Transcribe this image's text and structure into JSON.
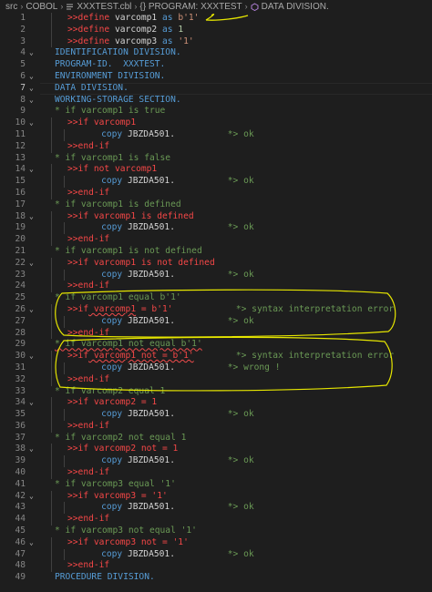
{
  "breadcrumb": {
    "items": [
      "src",
      "COBOL",
      "XXXTEST.cbl",
      "{} PROGRAM: XXXTEST",
      "DATA DIVISION."
    ]
  },
  "editor": {
    "current_line": 7,
    "lines": [
      {
        "n": "1",
        "fold": "",
        "indent": 1,
        "tokens": [
          [
            ">>define",
            "dir"
          ],
          [
            " varcomp1 ",
            "plain"
          ],
          [
            "as",
            "kw"
          ],
          [
            " b'1'",
            "str"
          ]
        ]
      },
      {
        "n": "2",
        "fold": "",
        "indent": 1,
        "tokens": [
          [
            ">>define",
            "dir"
          ],
          [
            " varcomp2 ",
            "plain"
          ],
          [
            "as",
            "kw"
          ],
          [
            " 1",
            "num"
          ]
        ]
      },
      {
        "n": "3",
        "fold": "",
        "indent": 1,
        "tokens": [
          [
            ">>define",
            "dir"
          ],
          [
            " varcomp3 ",
            "plain"
          ],
          [
            "as",
            "kw"
          ],
          [
            " '1'",
            "str"
          ]
        ]
      },
      {
        "n": "4",
        "fold": "v",
        "indent": 0,
        "tokens": [
          [
            "IDENTIFICATION DIVISION.",
            "div"
          ]
        ]
      },
      {
        "n": "5",
        "fold": "",
        "indent": 0,
        "tokens": [
          [
            "PROGRAM-ID.  XXXTEST.",
            "div"
          ]
        ]
      },
      {
        "n": "6",
        "fold": "v",
        "indent": 0,
        "tokens": [
          [
            "ENVIRONMENT DIVISION.",
            "div"
          ]
        ]
      },
      {
        "n": "7",
        "fold": "v",
        "indent": 0,
        "tokens": [
          [
            "DATA DIVISION.",
            "div"
          ]
        ]
      },
      {
        "n": "8",
        "fold": "v",
        "indent": 0,
        "tokens": [
          [
            "WORKING-STORAGE SECTION.",
            "div"
          ]
        ]
      },
      {
        "n": "9",
        "fold": "",
        "indent": 0,
        "tokens": [
          [
            "* if varcomp1 is true",
            "com"
          ]
        ]
      },
      {
        "n": "10",
        "fold": "v",
        "indent": 1,
        "tokens": [
          [
            ">>if",
            "dir"
          ],
          [
            " varcomp1",
            "err"
          ]
        ]
      },
      {
        "n": "11",
        "fold": "",
        "indent": 2,
        "tokens": [
          [
            "    copy ",
            "kw"
          ],
          [
            "JBZDA501",
            "id"
          ],
          [
            ".",
            "plain"
          ],
          [
            "          *> ok",
            "com"
          ]
        ]
      },
      {
        "n": "12",
        "fold": "",
        "indent": 1,
        "tokens": [
          [
            ">>end-if",
            "dir"
          ]
        ]
      },
      {
        "n": "13",
        "fold": "",
        "indent": 0,
        "tokens": [
          [
            "* if varcomp1 is false",
            "com"
          ]
        ]
      },
      {
        "n": "14",
        "fold": "v",
        "indent": 1,
        "tokens": [
          [
            ">>if",
            "dir"
          ],
          [
            " not varcomp1",
            "err"
          ]
        ]
      },
      {
        "n": "15",
        "fold": "",
        "indent": 2,
        "tokens": [
          [
            "    copy ",
            "kw"
          ],
          [
            "JBZDA501",
            "id"
          ],
          [
            ".",
            "plain"
          ],
          [
            "          *> ok",
            "com"
          ]
        ]
      },
      {
        "n": "16",
        "fold": "",
        "indent": 1,
        "tokens": [
          [
            ">>end-if",
            "dir"
          ]
        ]
      },
      {
        "n": "17",
        "fold": "",
        "indent": 0,
        "tokens": [
          [
            "* if varcomp1 is defined",
            "com"
          ]
        ]
      },
      {
        "n": "18",
        "fold": "v",
        "indent": 1,
        "tokens": [
          [
            ">>if",
            "dir"
          ],
          [
            " varcomp1 is defined",
            "err"
          ]
        ]
      },
      {
        "n": "19",
        "fold": "",
        "indent": 2,
        "tokens": [
          [
            "    copy ",
            "kw"
          ],
          [
            "JBZDA501",
            "id"
          ],
          [
            ".",
            "plain"
          ],
          [
            "          *> ok",
            "com"
          ]
        ]
      },
      {
        "n": "20",
        "fold": "",
        "indent": 1,
        "tokens": [
          [
            ">>end-if",
            "dir"
          ]
        ]
      },
      {
        "n": "21",
        "fold": "",
        "indent": 0,
        "tokens": [
          [
            "* if varcomp1 is not defined",
            "com"
          ]
        ]
      },
      {
        "n": "22",
        "fold": "v",
        "indent": 1,
        "tokens": [
          [
            ">>if",
            "dir"
          ],
          [
            " varcomp1 is not defined",
            "err"
          ]
        ]
      },
      {
        "n": "23",
        "fold": "",
        "indent": 2,
        "tokens": [
          [
            "    copy ",
            "kw"
          ],
          [
            "JBZDA501",
            "id"
          ],
          [
            ".",
            "plain"
          ],
          [
            "          *> ok",
            "com"
          ]
        ]
      },
      {
        "n": "24",
        "fold": "",
        "indent": 1,
        "tokens": [
          [
            ">>end-if",
            "dir"
          ]
        ]
      },
      {
        "n": "25",
        "fold": "",
        "indent": 0,
        "tokens": [
          [
            "* if varcomp1 equal b'1'",
            "com"
          ]
        ]
      },
      {
        "n": "26",
        "fold": "v",
        "indent": 1,
        "tokens": [
          [
            ">>if",
            "dir"
          ],
          [
            " varcomp1",
            "err squig"
          ],
          [
            " = b'1'",
            "err"
          ],
          [
            "            *> syntax interpretation error",
            "com"
          ]
        ]
      },
      {
        "n": "27",
        "fold": "",
        "indent": 2,
        "tokens": [
          [
            "    copy ",
            "kw"
          ],
          [
            "JBZDA501",
            "id"
          ],
          [
            ".",
            "plain"
          ],
          [
            "          *> ok",
            "com"
          ]
        ]
      },
      {
        "n": "28",
        "fold": "",
        "indent": 1,
        "tokens": [
          [
            ">>end-if",
            "dir"
          ]
        ]
      },
      {
        "n": "29",
        "fold": "",
        "indent": 0,
        "tokens": [
          [
            "* if varcomp1 not equal b'1'",
            "com squig"
          ]
        ]
      },
      {
        "n": "30",
        "fold": "v",
        "indent": 1,
        "tokens": [
          [
            ">>if",
            "dir"
          ],
          [
            " varcomp1 not = b'1'",
            "err squig"
          ],
          [
            "        *> syntax interpretation error",
            "com"
          ]
        ]
      },
      {
        "n": "31",
        "fold": "",
        "indent": 2,
        "tokens": [
          [
            "    copy ",
            "kw"
          ],
          [
            "JBZDA501",
            "id"
          ],
          [
            ".",
            "plain"
          ],
          [
            "          *> wrong !",
            "com"
          ]
        ]
      },
      {
        "n": "32",
        "fold": "",
        "indent": 1,
        "tokens": [
          [
            ">>end-if",
            "dir"
          ]
        ]
      },
      {
        "n": "33",
        "fold": "",
        "indent": 0,
        "tokens": [
          [
            "* if varcomp2 equal 1",
            "com"
          ]
        ]
      },
      {
        "n": "34",
        "fold": "v",
        "indent": 1,
        "tokens": [
          [
            ">>if",
            "dir"
          ],
          [
            " varcomp2 = 1",
            "err"
          ]
        ]
      },
      {
        "n": "35",
        "fold": "",
        "indent": 2,
        "tokens": [
          [
            "    copy ",
            "kw"
          ],
          [
            "JBZDA501",
            "id"
          ],
          [
            ".",
            "plain"
          ],
          [
            "          *> ok",
            "com"
          ]
        ]
      },
      {
        "n": "36",
        "fold": "",
        "indent": 1,
        "tokens": [
          [
            ">>end-if",
            "dir"
          ]
        ]
      },
      {
        "n": "37",
        "fold": "",
        "indent": 0,
        "tokens": [
          [
            "* if varcomp2 not equal 1",
            "com"
          ]
        ]
      },
      {
        "n": "38",
        "fold": "v",
        "indent": 1,
        "tokens": [
          [
            ">>if",
            "dir"
          ],
          [
            " varcomp2 not = 1",
            "err"
          ]
        ]
      },
      {
        "n": "39",
        "fold": "",
        "indent": 2,
        "tokens": [
          [
            "    copy ",
            "kw"
          ],
          [
            "JBZDA501",
            "id"
          ],
          [
            ".",
            "plain"
          ],
          [
            "          *> ok",
            "com"
          ]
        ]
      },
      {
        "n": "40",
        "fold": "",
        "indent": 1,
        "tokens": [
          [
            ">>end-if",
            "dir"
          ]
        ]
      },
      {
        "n": "41",
        "fold": "",
        "indent": 0,
        "tokens": [
          [
            "* if varcomp3 equal '1'",
            "com"
          ]
        ]
      },
      {
        "n": "42",
        "fold": "v",
        "indent": 1,
        "tokens": [
          [
            ">>if",
            "dir"
          ],
          [
            " varcomp3 = '1'",
            "err"
          ]
        ]
      },
      {
        "n": "43",
        "fold": "",
        "indent": 2,
        "tokens": [
          [
            "    copy ",
            "kw"
          ],
          [
            "JBZDA501",
            "id"
          ],
          [
            ".",
            "plain"
          ],
          [
            "          *> ok",
            "com"
          ]
        ]
      },
      {
        "n": "44",
        "fold": "",
        "indent": 1,
        "tokens": [
          [
            ">>end-if",
            "dir"
          ]
        ]
      },
      {
        "n": "45",
        "fold": "",
        "indent": 0,
        "tokens": [
          [
            "* if varcomp3 not equal '1'",
            "com"
          ]
        ]
      },
      {
        "n": "46",
        "fold": "v",
        "indent": 1,
        "tokens": [
          [
            ">>if",
            "dir"
          ],
          [
            " varcomp3 not = '1'",
            "err"
          ]
        ]
      },
      {
        "n": "47",
        "fold": "",
        "indent": 2,
        "tokens": [
          [
            "    copy ",
            "kw"
          ],
          [
            "JBZDA501",
            "id"
          ],
          [
            ".",
            "plain"
          ],
          [
            "          *> ok",
            "com"
          ]
        ]
      },
      {
        "n": "48",
        "fold": "",
        "indent": 1,
        "tokens": [
          [
            ">>end-if",
            "dir"
          ]
        ]
      },
      {
        "n": "49",
        "fold": "",
        "indent": 0,
        "tokens": [
          [
            "PROCEDURE DIVISION.",
            "div"
          ]
        ]
      }
    ]
  },
  "annotation_color": "#e6e600"
}
